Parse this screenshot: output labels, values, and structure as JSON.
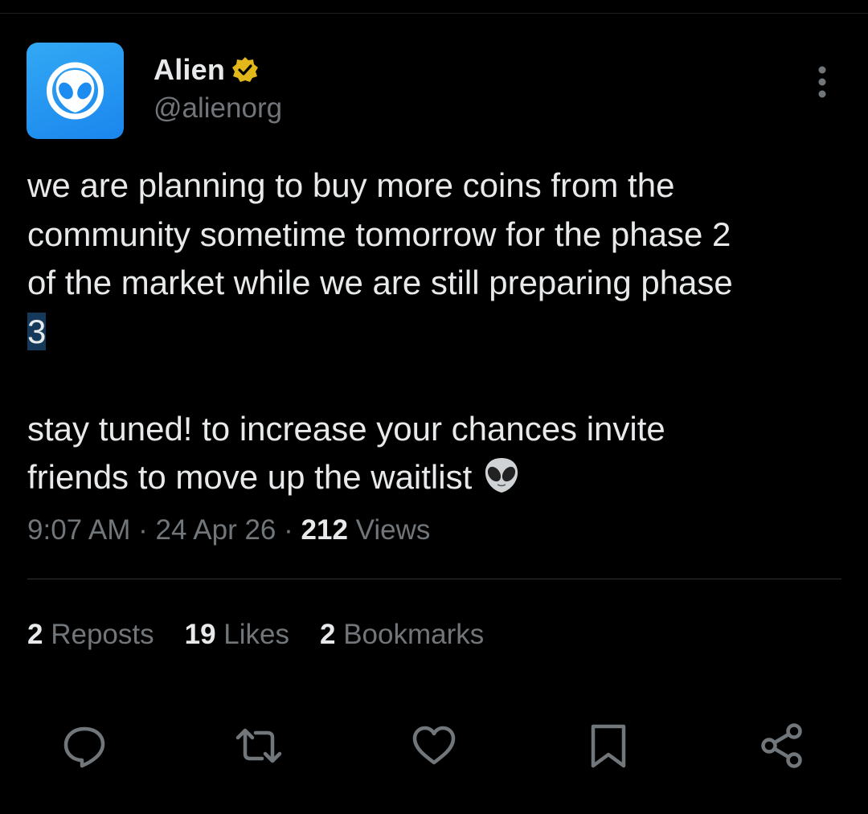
{
  "author": {
    "display_name": "Alien",
    "handle": "@alienorg",
    "verified": true,
    "avatar_icon": "alien-face-icon",
    "avatar_color": "#1d8cf0"
  },
  "tweet": {
    "line1": "we are planning to buy more coins from the",
    "line2": "community sometime tomorrow for the phase 2",
    "line3": "of the market while we are still preparing phase",
    "line4": "3",
    "line5": "stay tuned! to increase your chances invite",
    "line6": "friends to move up the waitlist",
    "emoji": "alien-emoji"
  },
  "meta": {
    "time": "9:07 AM",
    "date": "24 Apr 26",
    "views_count": "212",
    "views_label": "Views",
    "separator": "·"
  },
  "stats": {
    "reposts_count": "2",
    "reposts_label": "Reposts",
    "likes_count": "19",
    "likes_label": "Likes",
    "bookmarks_count": "2",
    "bookmarks_label": "Bookmarks"
  },
  "actions": [
    "reply-icon",
    "repost-icon",
    "like-icon",
    "bookmark-icon",
    "share-icon"
  ],
  "colors": {
    "background": "#000000",
    "text": "#e7e9ea",
    "secondary_text": "#71767b",
    "verified_badge": "#e2b719"
  }
}
